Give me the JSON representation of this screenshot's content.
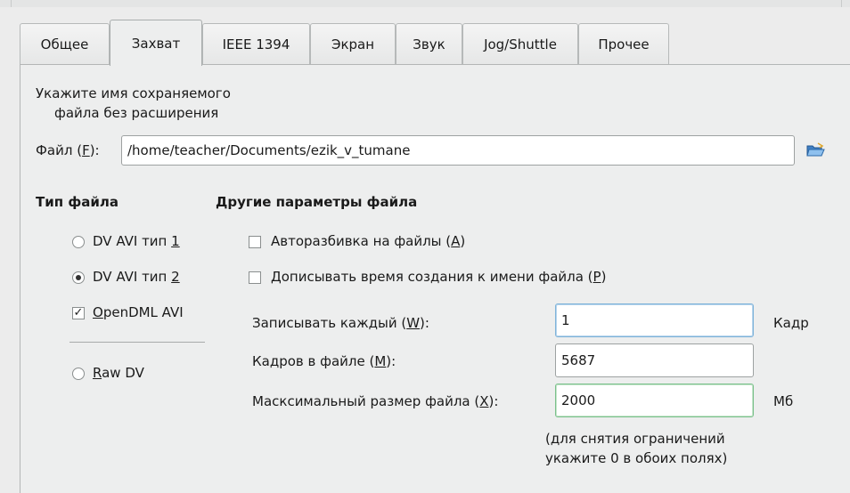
{
  "tabs": [
    {
      "label": "Общее"
    },
    {
      "label": "Захват"
    },
    {
      "label": "IEEE 1394"
    },
    {
      "label": "Экран"
    },
    {
      "label": "Звук"
    },
    {
      "label": "Jog/Shuttle"
    },
    {
      "label": "Прочее"
    }
  ],
  "active_tab": "Захват",
  "hint": {
    "line1": "Укажите имя сохраняемого",
    "line2": "файла без расширения"
  },
  "file": {
    "label_pre": "Файл (",
    "label_key": "F",
    "label_post": "):",
    "value": "/home/teacher/Documents/ezik_v_tumane",
    "browse_icon": "folder-open-icon"
  },
  "file_type": {
    "heading": "Тип файла",
    "options": [
      {
        "pre": "DV AVI тип ",
        "key": "1",
        "post": "",
        "selected": false
      },
      {
        "pre": "DV AVI тип ",
        "key": "2",
        "post": "",
        "selected": true
      },
      {
        "pre": "",
        "key": "O",
        "post": "penDML AVI",
        "checked": true
      },
      {
        "pre": "",
        "key": "R",
        "post": "aw DV",
        "selected": false
      }
    ]
  },
  "other": {
    "heading": "Другие параметры файла",
    "autosplit": {
      "pre": "Авторазбивка на файлы (",
      "key": "A",
      "post": ")",
      "checked": false
    },
    "append_time": {
      "pre": "Дописывать время создания к имени файла (",
      "key": "P",
      "post": ")",
      "checked": false
    },
    "every": {
      "pre": "Записывать каждый (",
      "key": "W",
      "post": "):",
      "value": "1",
      "unit": "Кадр"
    },
    "frames": {
      "pre": "Кадров в файле (",
      "key": "M",
      "post": "):",
      "value": "5687"
    },
    "maxsize": {
      "pre": "Масксимальный размер файла (",
      "key": "X",
      "post": "):",
      "value": "2000",
      "unit": "Мб"
    },
    "note_line1": "(для снятия ограничений",
    "note_line2": "укажите 0 в обоих полях)"
  }
}
